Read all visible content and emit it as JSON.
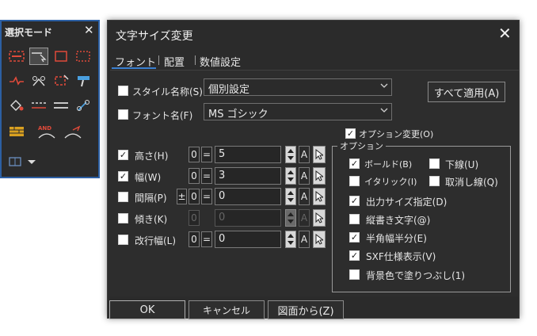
{
  "palette": {
    "title": "選択モード",
    "close": "✕",
    "tools": [
      "group-select-icon",
      "pick-select-icon",
      "rect-select-icon",
      "dotted-rect-select-icon",
      "line-select-icon",
      "node-select-icon",
      "crop-select-icon",
      "paint-select-icon",
      "fill-select-icon",
      "dashed-line-icon",
      "double-line-icon",
      "hook-select-icon",
      "brick-pattern-icon",
      "and-select-icon",
      "redo-select-icon",
      "layer-dropdown-icon"
    ]
  },
  "dialog": {
    "title": "文字サイズ変更",
    "close": "✕",
    "tabs": [
      "フォント",
      "配置",
      "数値設定"
    ],
    "style_name": {
      "label": "スタイル名称(S)",
      "value": "個別設定"
    },
    "font_name": {
      "label": "フォント名(F)",
      "value": "MS ゴシック"
    },
    "apply_all": "すべて適用(A)",
    "option_change": "オプション変更(O)",
    "rows": [
      {
        "label": "高さ(H)",
        "checked": true,
        "prefix": "0",
        "eq": "=",
        "value": "5",
        "pm": null
      },
      {
        "label": "幅(W)",
        "checked": true,
        "prefix": "0",
        "eq": "=",
        "value": "3",
        "pm": null
      },
      {
        "label": "間隔(P)",
        "checked": false,
        "prefix": "0",
        "eq": "=",
        "value": "0",
        "pm": "±"
      },
      {
        "label": "傾き(K)",
        "checked": false,
        "prefix": "0",
        "eq": "",
        "value": "0",
        "pm": null,
        "disabled": true
      },
      {
        "label": "改行幅(L)",
        "checked": false,
        "prefix": "0",
        "eq": "=",
        "value": "0",
        "pm": null
      }
    ],
    "a_label": "A",
    "options": {
      "title": "オプション",
      "items": [
        {
          "label": "ボールド(B)",
          "checked": true
        },
        {
          "label": "下線(U)",
          "checked": false
        },
        {
          "label": "イタリック(I)",
          "checked": false
        },
        {
          "label": "取消し線(Q)",
          "checked": false
        },
        {
          "label": "出力サイズ指定(D)",
          "checked": true
        },
        {
          "label": "縦書き文字(@)",
          "checked": false
        },
        {
          "label": "半角幅半分(E)",
          "checked": true
        },
        {
          "label": "SXF仕様表示(V)",
          "checked": true
        },
        {
          "label": "背景色で塗りつぶし(1)",
          "checked": false
        }
      ]
    },
    "buttons": {
      "ok": "OK",
      "cancel": "キャンセル",
      "from_drawing": "図面から(Z)"
    }
  },
  "colors": {
    "accent": "#3a7fd0",
    "palette_border": "#2c5fa3",
    "icon_red": "#e04a3a",
    "icon_blue": "#4aa0e0"
  }
}
